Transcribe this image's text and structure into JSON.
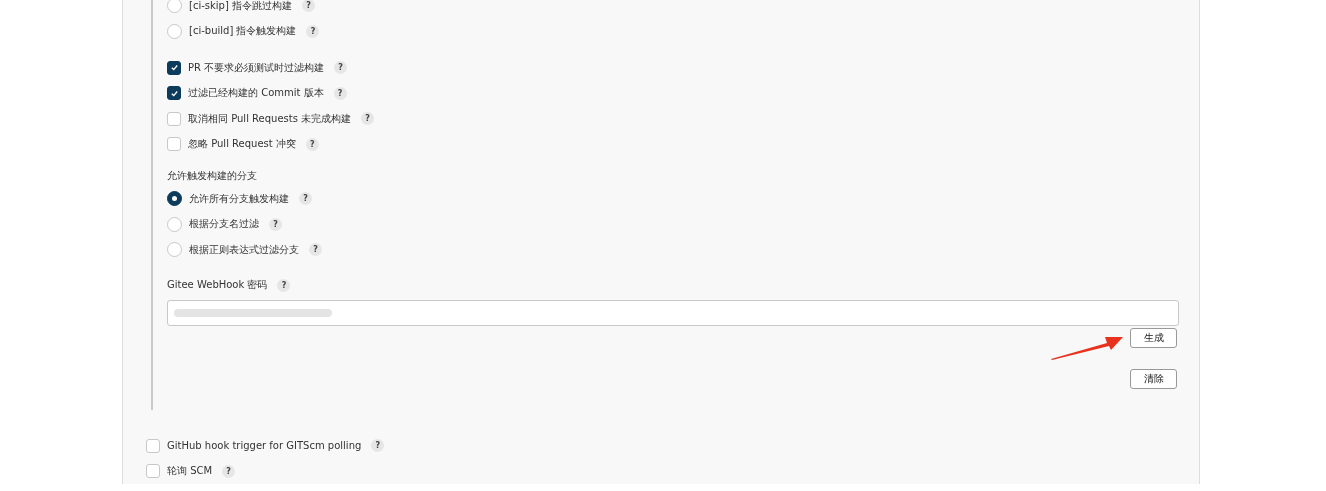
{
  "skip_options": [
    {
      "kind": "radio",
      "label": "[ci-skip] 指令跳过构建",
      "help": "?",
      "selected": false
    },
    {
      "kind": "radio",
      "label": "[ci-build] 指令触发构建",
      "help": "?",
      "selected": false
    }
  ],
  "filters": [
    {
      "kind": "checkbox",
      "label": "PR 不要求必须测试时过滤构建",
      "help": "?",
      "checked": true
    },
    {
      "kind": "checkbox",
      "label": "过滤已经构建的 Commit 版本",
      "help": "?",
      "checked": true
    },
    {
      "kind": "checkbox",
      "label": "取消相同 Pull Requests 未完成构建",
      "help": "?",
      "checked": false
    },
    {
      "kind": "checkbox",
      "label": "忽略 Pull Request 冲突",
      "help": "?",
      "checked": false
    }
  ],
  "branches": {
    "title": "允许触发构建的分支",
    "options": [
      {
        "kind": "radio",
        "label": "允许所有分支触发构建",
        "help": "?",
        "selected": true
      },
      {
        "kind": "radio",
        "label": "根据分支名过滤",
        "help": "?",
        "selected": false
      },
      {
        "kind": "radio",
        "label": "根据正则表达式过滤分支",
        "help": "?",
        "selected": false
      }
    ]
  },
  "webhook": {
    "label": "Gitee WebHook 密码",
    "help": "?",
    "buttons": [
      "生成",
      "清除"
    ]
  },
  "triggers": [
    {
      "kind": "checkbox",
      "label": "GitHub hook trigger for GITScm polling",
      "help": "?",
      "checked": false
    },
    {
      "kind": "checkbox",
      "label": "轮询 SCM",
      "help": "?",
      "checked": false
    }
  ]
}
